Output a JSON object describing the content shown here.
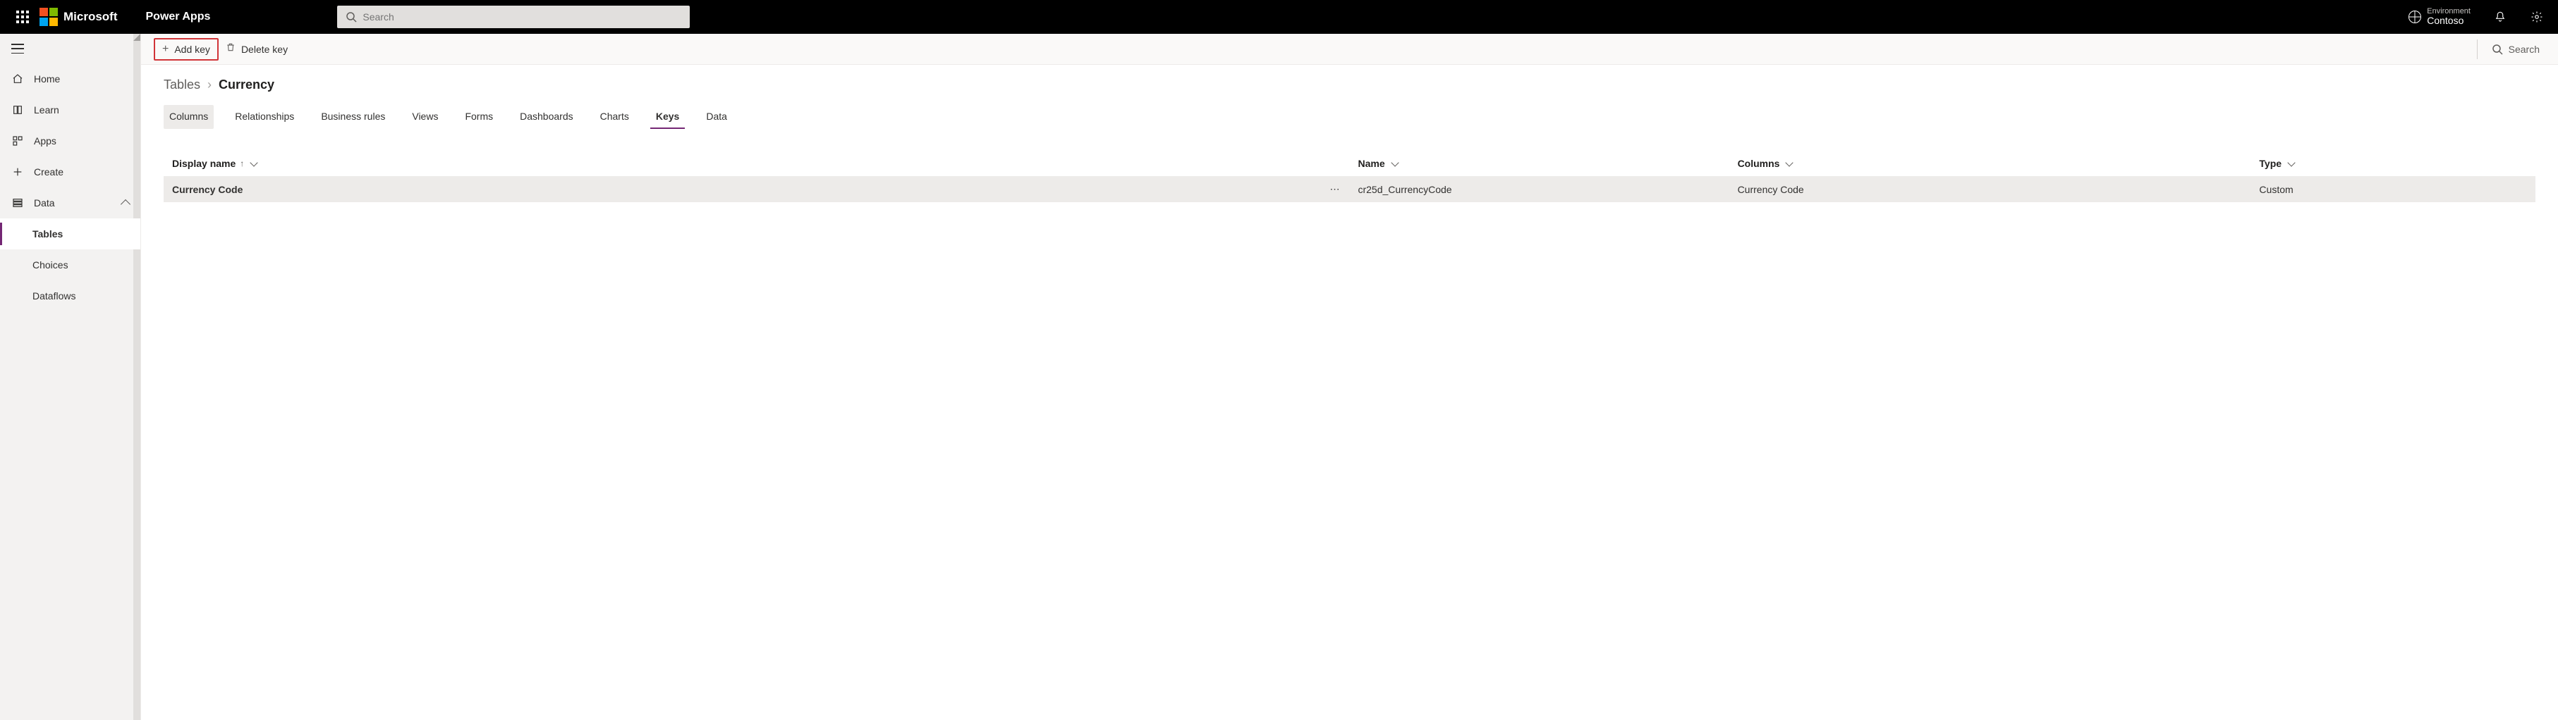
{
  "header": {
    "brand": "Microsoft",
    "app_name": "Power Apps",
    "search_placeholder": "Search",
    "environment_label": "Environment",
    "environment_name": "Contoso"
  },
  "sidebar": {
    "items": [
      {
        "label": "Home"
      },
      {
        "label": "Learn"
      },
      {
        "label": "Apps"
      },
      {
        "label": "Create"
      },
      {
        "label": "Data"
      }
    ],
    "data_children": [
      {
        "label": "Tables"
      },
      {
        "label": "Choices"
      },
      {
        "label": "Dataflows"
      }
    ]
  },
  "cmdbar": {
    "add_key": "Add key",
    "delete_key": "Delete key",
    "search": "Search"
  },
  "breadcrumb": {
    "parent": "Tables",
    "current": "Currency"
  },
  "tabs": [
    {
      "label": "Columns"
    },
    {
      "label": "Relationships"
    },
    {
      "label": "Business rules"
    },
    {
      "label": "Views"
    },
    {
      "label": "Forms"
    },
    {
      "label": "Dashboards"
    },
    {
      "label": "Charts"
    },
    {
      "label": "Keys"
    },
    {
      "label": "Data"
    }
  ],
  "table": {
    "headers": {
      "display_name": "Display name",
      "name": "Name",
      "columns": "Columns",
      "type": "Type"
    },
    "rows": [
      {
        "display_name": "Currency Code",
        "name": "cr25d_CurrencyCode",
        "columns": "Currency Code",
        "type": "Custom"
      }
    ]
  }
}
